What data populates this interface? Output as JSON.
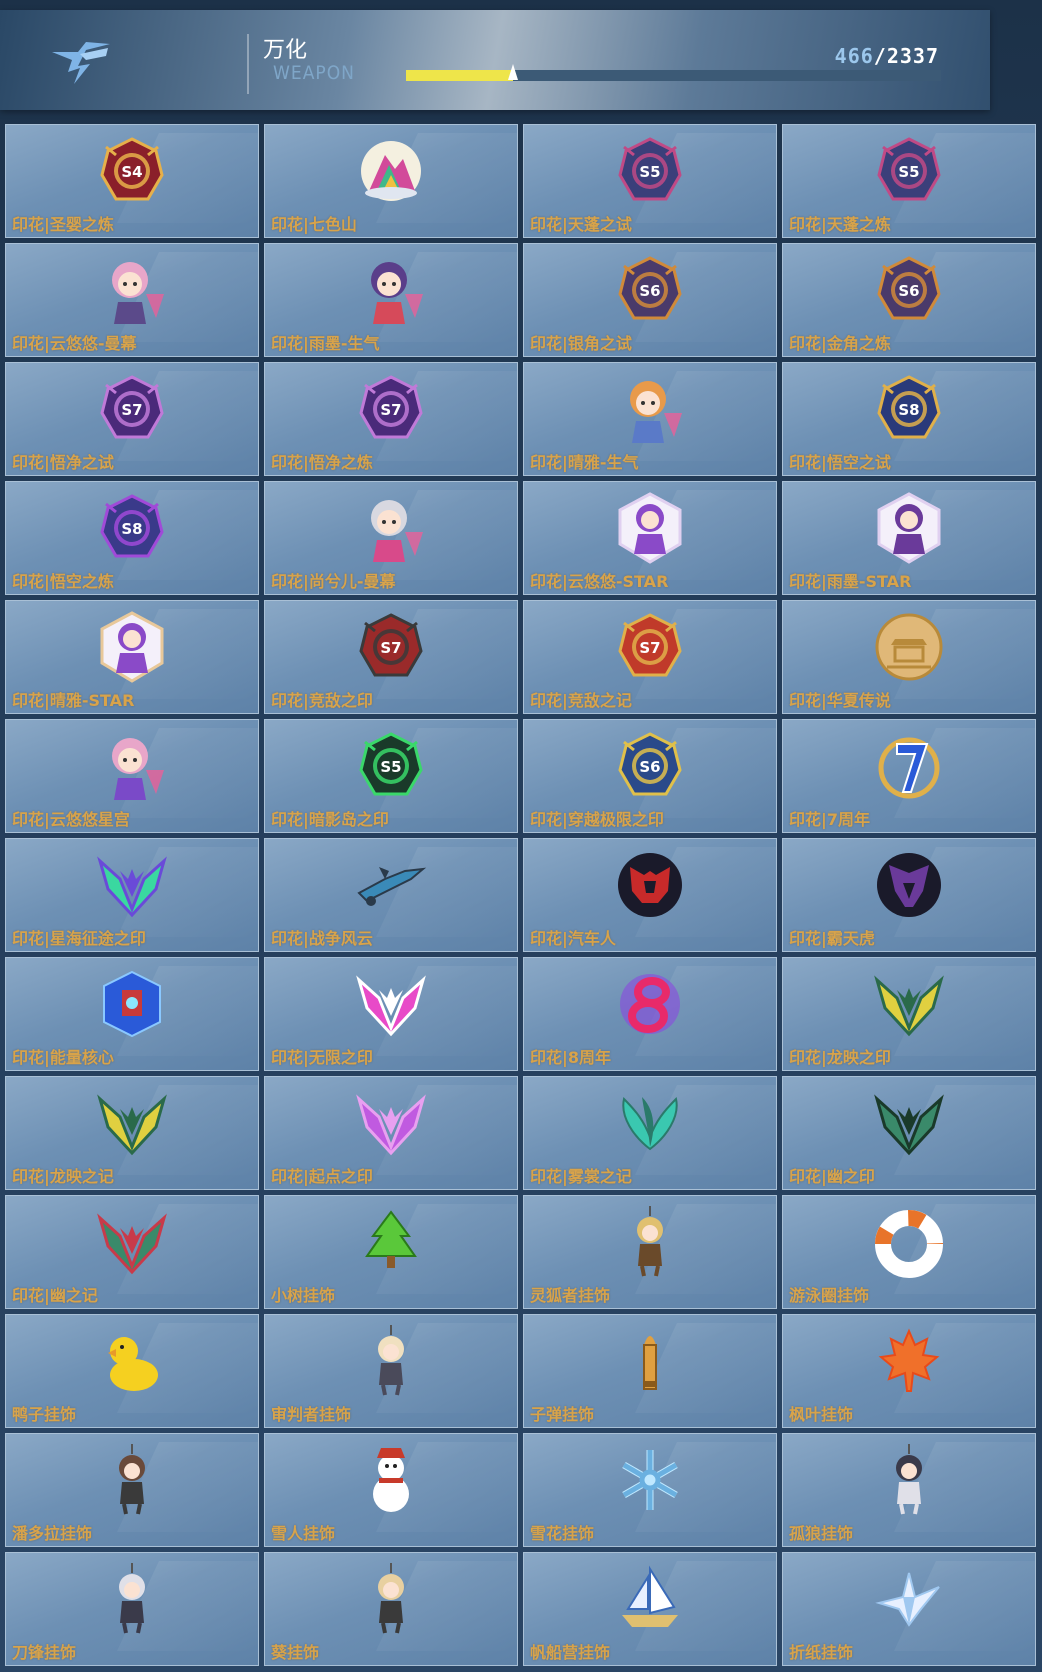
{
  "header": {
    "title_cn": "万化",
    "title_en": "WEAPON",
    "progress": {
      "current": "466",
      "separator": "/",
      "total": "2337",
      "fraction": 0.2
    }
  },
  "colors": {
    "label": "#d8a34a",
    "progress_fill": "#eee54a",
    "count_current": "#9cc7ec"
  },
  "items": [
    {
      "label": "印花|圣婴之炼",
      "icon": "season-badge-icon",
      "badge": "S4",
      "c1": "#8a1f2a",
      "c2": "#e6b04a"
    },
    {
      "label": "印花|七色山",
      "icon": "rainbow-mountain-icon",
      "c1": "#d24a9a",
      "c2": "#3fb88a"
    },
    {
      "label": "印花|天蓬之试",
      "icon": "season-badge-icon",
      "badge": "S5",
      "c1": "#3b3f7a",
      "c2": "#c04a86"
    },
    {
      "label": "印花|天蓬之炼",
      "icon": "season-badge-icon",
      "badge": "S5",
      "c1": "#3b3f7a",
      "c2": "#c04a86"
    },
    {
      "label": "印花|云悠悠-曼幕",
      "icon": "chibi-character-icon",
      "c1": "#e8a6c9",
      "c2": "#5b4a8a"
    },
    {
      "label": "印花|雨墨-生气",
      "icon": "chibi-character-icon",
      "c1": "#5a3e8a",
      "c2": "#d64a5a"
    },
    {
      "label": "印花|银角之试",
      "icon": "season-badge-icon",
      "badge": "S6",
      "c1": "#4a3a6a",
      "c2": "#d08a3a"
    },
    {
      "label": "印花|金角之炼",
      "icon": "season-badge-icon",
      "badge": "S6",
      "c1": "#4a3a6a",
      "c2": "#d08a3a"
    },
    {
      "label": "印花|悟净之试",
      "icon": "season-badge-icon",
      "badge": "S7",
      "c1": "#4a2a7a",
      "c2": "#c07ad8"
    },
    {
      "label": "印花|悟净之炼",
      "icon": "season-badge-icon",
      "badge": "S7",
      "c1": "#4a2a7a",
      "c2": "#c07ad8"
    },
    {
      "label": "印花|晴雅-生气",
      "icon": "chibi-character-icon",
      "c1": "#e89a4a",
      "c2": "#5a7ac8"
    },
    {
      "label": "印花|悟空之试",
      "icon": "season-badge-icon",
      "badge": "S8",
      "c1": "#2a3a7a",
      "c2": "#e0b04a"
    },
    {
      "label": "印花|悟空之炼",
      "icon": "season-badge-icon",
      "badge": "S8",
      "c1": "#3a3a8a",
      "c2": "#a04ad8"
    },
    {
      "label": "印花|尚兮儿-曼幕",
      "icon": "chibi-character-icon",
      "c1": "#d8d8e0",
      "c2": "#d84a8a"
    },
    {
      "label": "印花|云悠悠-STAR",
      "icon": "star-portrait-icon",
      "c1": "#8a4ac8",
      "c2": "#e0d0f0"
    },
    {
      "label": "印花|雨墨-STAR",
      "icon": "star-portrait-icon",
      "c1": "#6a3a9a",
      "c2": "#e0d0f0"
    },
    {
      "label": "印花|晴雅-STAR",
      "icon": "star-portrait-icon",
      "c1": "#8a4ac8",
      "c2": "#e8c89a"
    },
    {
      "label": "印花|竞敌之印",
      "icon": "season-badge-icon",
      "badge": "S7",
      "c1": "#9a2a2a",
      "c2": "#3a3a3a"
    },
    {
      "label": "印花|竞敌之记",
      "icon": "season-badge-icon",
      "badge": "S7",
      "c1": "#c03a2a",
      "c2": "#e0b04a"
    },
    {
      "label": "印花|华夏传说",
      "icon": "gold-coin-icon",
      "c1": "#e0b878",
      "c2": "#b88a3a"
    },
    {
      "label": "印花|云悠悠星宫",
      "icon": "chibi-character-icon",
      "c1": "#e8a6c9",
      "c2": "#7a4ac8"
    },
    {
      "label": "印花|暗影岛之印",
      "icon": "season-badge-icon",
      "badge": "S5",
      "c1": "#1a3a2a",
      "c2": "#3ad86a"
    },
    {
      "label": "印花|穿越极限之印",
      "icon": "season-badge-icon",
      "badge": "S6",
      "c1": "#2a4a8a",
      "c2": "#e0c04a"
    },
    {
      "label": "印花|7周年",
      "icon": "anniversary-seven-icon",
      "c1": "#2a5ad8",
      "c2": "#e0b04a"
    },
    {
      "label": "印花|星海征途之印",
      "icon": "v-wing-emblem-icon",
      "c1": "#3ad8a0",
      "c2": "#6a4ad8"
    },
    {
      "label": "印花|战争风云",
      "icon": "aircraft-icon",
      "c1": "#3a8ab8",
      "c2": "#2a3a4a"
    },
    {
      "label": "印花|汽车人",
      "icon": "autobot-emblem-icon",
      "c1": "#c82a2a",
      "c2": "#1a1a2a"
    },
    {
      "label": "印花|霸天虎",
      "icon": "decepticon-emblem-icon",
      "c1": "#6a3a9a",
      "c2": "#1a1a2a"
    },
    {
      "label": "印花|能量核心",
      "icon": "robot-core-icon",
      "c1": "#2a5ad8",
      "c2": "#c83a3a"
    },
    {
      "label": "印花|无限之印",
      "icon": "v-wing-emblem-icon",
      "c1": "#e84ac8",
      "c2": "#ffffff"
    },
    {
      "label": "印花|8周年",
      "icon": "anniversary-eight-icon",
      "c1": "#e82a6a",
      "c2": "#8a4ae0"
    },
    {
      "label": "印花|龙映之印",
      "icon": "v-wing-emblem-icon",
      "c1": "#e0d040",
      "c2": "#2a6a4a"
    },
    {
      "label": "印花|龙映之记",
      "icon": "v-wing-emblem-icon",
      "c1": "#e0d040",
      "c2": "#2a6a4a"
    },
    {
      "label": "印花|起点之印",
      "icon": "v-wing-emblem-icon",
      "c1": "#c05ae0",
      "c2": "#e8a0f0"
    },
    {
      "label": "印花|雾裳之记",
      "icon": "leaf-emblem-icon",
      "c1": "#3ac8b0",
      "c2": "#2a7a6a"
    },
    {
      "label": "印花|幽之印",
      "icon": "v-wing-emblem-icon",
      "c1": "#3a8a6a",
      "c2": "#1a3a2a"
    },
    {
      "label": "印花|幽之记",
      "icon": "v-wing-emblem-icon",
      "c1": "#3a8a6a",
      "c2": "#c83a4a"
    },
    {
      "label": "小树挂饰",
      "icon": "tree-charm-icon",
      "c1": "#5ac83a",
      "c2": "#2a7a1a"
    },
    {
      "label": "灵狐者挂饰",
      "icon": "chibi-charm-icon",
      "c1": "#e0c070",
      "c2": "#6a4a2a"
    },
    {
      "label": "游泳圈挂饰",
      "icon": "swim-ring-charm-icon",
      "c1": "#ffffff",
      "c2": "#e8742a"
    },
    {
      "label": "鸭子挂饰",
      "icon": "duck-charm-icon",
      "c1": "#f5d020",
      "c2": "#e89a2a"
    },
    {
      "label": "审判者挂饰",
      "icon": "chibi-charm-icon",
      "c1": "#f0e0c0",
      "c2": "#4a4a5a"
    },
    {
      "label": "子弹挂饰",
      "icon": "bullet-charm-icon",
      "c1": "#e0a040",
      "c2": "#8a5a1a"
    },
    {
      "label": "枫叶挂饰",
      "icon": "maple-leaf-charm-icon",
      "c1": "#f0702a",
      "c2": "#e84a1a"
    },
    {
      "label": "潘多拉挂饰",
      "icon": "chibi-charm-icon",
      "c1": "#6a4a3a",
      "c2": "#3a3a3a"
    },
    {
      "label": "雪人挂饰",
      "icon": "snowman-charm-icon",
      "c1": "#ffffff",
      "c2": "#c83a2a"
    },
    {
      "label": "雪花挂饰",
      "icon": "snowflake-charm-icon",
      "c1": "#bfe8ff",
      "c2": "#6ab0e0"
    },
    {
      "label": "孤狼挂饰",
      "icon": "chibi-charm-icon",
      "c1": "#3a3a4a",
      "c2": "#e0e0e8"
    },
    {
      "label": "刀锋挂饰",
      "icon": "chibi-charm-icon",
      "c1": "#e0e0e8",
      "c2": "#3a3a4a"
    },
    {
      "label": "葵挂饰",
      "icon": "chibi-charm-icon",
      "c1": "#e8d0a0",
      "c2": "#3a3a3a"
    },
    {
      "label": "帆船营挂饰",
      "icon": "sailboat-charm-icon",
      "c1": "#e0c070",
      "c2": "#3a6ab8"
    },
    {
      "label": "折纸挂饰",
      "icon": "paper-crane-charm-icon",
      "c1": "#e8f0ff",
      "c2": "#a0c8f0"
    }
  ]
}
